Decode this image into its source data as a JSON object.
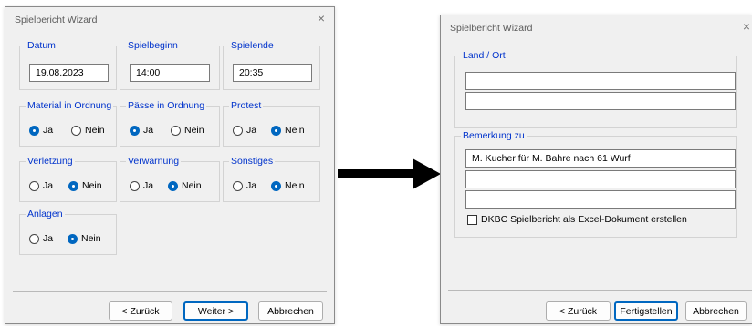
{
  "wizard1": {
    "title": "Spielbericht Wizard",
    "close": "×",
    "datum": {
      "label": "Datum",
      "value": "19.08.2023"
    },
    "spielbeginn": {
      "label": "Spielbeginn",
      "value": "14:00"
    },
    "spielende": {
      "label": "Spielende",
      "value": "20:35"
    },
    "material": {
      "label": "Material in Ordnung",
      "ja": "Ja",
      "nein": "Nein",
      "selected": "ja"
    },
    "paesse": {
      "label": "Pässe in Ordnung",
      "ja": "Ja",
      "nein": "Nein",
      "selected": "ja"
    },
    "protest": {
      "label": "Protest",
      "ja": "Ja",
      "nein": "Nein",
      "selected": "nein"
    },
    "verletzung": {
      "label": "Verletzung",
      "ja": "Ja",
      "nein": "Nein",
      "selected": "nein"
    },
    "verwarnung": {
      "label": "Verwarnung",
      "ja": "Ja",
      "nein": "Nein",
      "selected": "nein"
    },
    "sonstiges": {
      "label": "Sonstiges",
      "ja": "Ja",
      "nein": "Nein",
      "selected": "nein"
    },
    "anlagen": {
      "label": "Anlagen",
      "ja": "Ja",
      "nein": "Nein",
      "selected": "nein"
    },
    "buttons": {
      "back": "< Zurück",
      "next": "Weiter >",
      "cancel": "Abbrechen"
    }
  },
  "wizard2": {
    "title": "Spielbericht Wizard",
    "close": "×",
    "land_ort": {
      "label": "Land / Ort",
      "line1": "",
      "line2": ""
    },
    "bemerkung": {
      "label": "Bemerkung zu",
      "line1": "M. Kucher für M. Bahre nach 61 Wurf",
      "line2": "",
      "line3": ""
    },
    "excel_checkbox": {
      "label": "DKBC Spielbericht als Excel-Dokument erstellen",
      "checked": false
    },
    "buttons": {
      "back": "< Zurück",
      "finish": "Fertigstellen",
      "cancel": "Abbrechen"
    }
  },
  "colors": {
    "group_label": "#0033cc",
    "accent": "#0067c0",
    "arrow": "#000000"
  }
}
